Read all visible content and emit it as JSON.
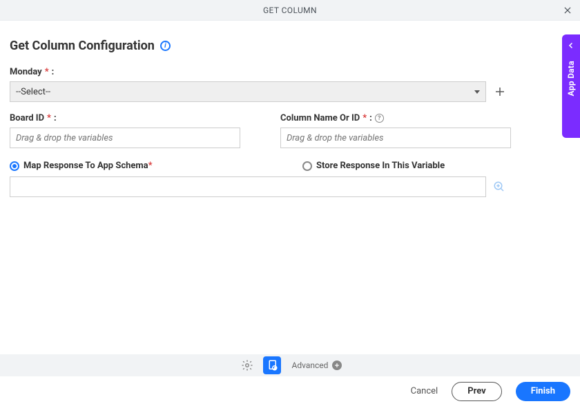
{
  "header": {
    "title": "GET COLUMN"
  },
  "page": {
    "title": "Get Column Configuration"
  },
  "sideTab": {
    "label": "App Data"
  },
  "fields": {
    "monday": {
      "label": "Monday",
      "required": "*",
      "colon": ":",
      "select_value": "--Select--"
    },
    "boardId": {
      "label": "Board ID",
      "required": "*",
      "colon": ":",
      "placeholder": "Drag & drop the variables"
    },
    "columnName": {
      "label": "Column Name Or ID",
      "required": "*",
      "colon": ":",
      "placeholder": "Drag & drop the variables"
    }
  },
  "radios": {
    "map": {
      "label": "Map Response To App Schema",
      "required": "*"
    },
    "store": {
      "label": "Store Response In This Variable"
    }
  },
  "toolbar": {
    "advanced": "Advanced"
  },
  "footer": {
    "cancel": "Cancel",
    "prev": "Prev",
    "finish": "Finish"
  }
}
